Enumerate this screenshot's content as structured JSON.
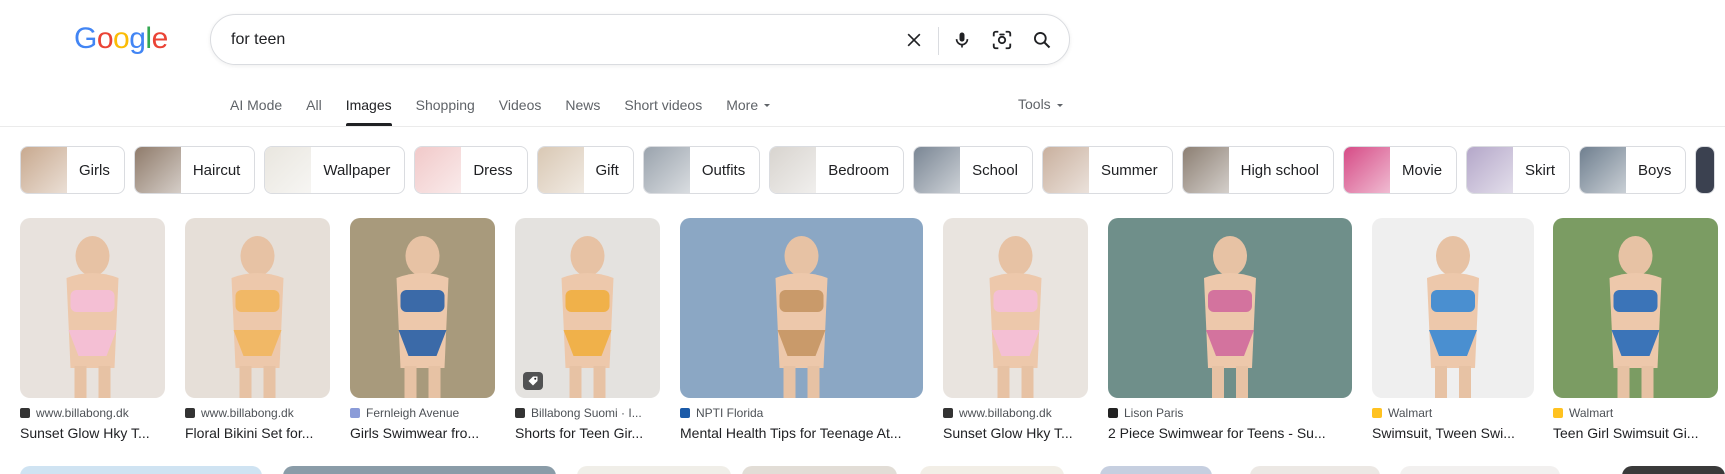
{
  "search": {
    "query": "for teen"
  },
  "nav": {
    "tabs": [
      "AI Mode",
      "All",
      "Images",
      "Shopping",
      "Videos",
      "News",
      "Short videos"
    ],
    "more_label": "More",
    "tools_label": "Tools",
    "active_tab": "Images"
  },
  "chips": [
    {
      "label": "Girls",
      "color": "#c8a98f"
    },
    {
      "label": "Haircut",
      "color": "#8f7b6b"
    },
    {
      "label": "Wallpaper",
      "color": "#e9e6df"
    },
    {
      "label": "Dress",
      "color": "#f1c9c9"
    },
    {
      "label": "Gift",
      "color": "#d9c8b4"
    },
    {
      "label": "Outfits",
      "color": "#9aa3ad"
    },
    {
      "label": "Bedroom",
      "color": "#d8d4cf"
    },
    {
      "label": "School",
      "color": "#7a8694"
    },
    {
      "label": "Summer",
      "color": "#c9b09e"
    },
    {
      "label": "High school",
      "color": "#8c7f73"
    },
    {
      "label": "Movie",
      "color": "#d64b86"
    },
    {
      "label": "Skirt",
      "color": "#b4a7c9"
    },
    {
      "label": "Boys",
      "color": "#6f7f8f"
    }
  ],
  "results": [
    {
      "source": "www.billabong.dk",
      "title": "Sunset Glow Hky T...",
      "img_color": "#e8e2dd",
      "accent": "#f4bfd4",
      "fav_color": "#333333"
    },
    {
      "source": "www.billabong.dk",
      "title": "Floral Bikini Set for...",
      "img_color": "#e6dfd8",
      "accent": "#f1b866",
      "fav_color": "#333333"
    },
    {
      "source": "Fernleigh Avenue",
      "title": "Girls Swimwear fro...",
      "img_color": "#a89a7c",
      "accent": "#3b6aa8",
      "fav_color": "#8a9bd8"
    },
    {
      "source": "Billabong Suomi · I...",
      "title": "Shorts for Teen Gir...",
      "img_color": "#e4e2df",
      "accent": "#f0b14a",
      "fav_color": "#333333"
    },
    {
      "source": "NPTI Florida",
      "title": "Mental Health Tips for Teenage At...",
      "img_color": "#8ba7c4",
      "accent": "#c99a6a",
      "fav_color": "#1a5aa8"
    },
    {
      "source": "www.billabong.dk",
      "title": "Sunset Glow Hky T...",
      "img_color": "#e9e4df",
      "accent": "#f4bfd4",
      "fav_color": "#333333"
    },
    {
      "source": "Lison Paris",
      "title": "2 Piece Swimwear for Teens - Su...",
      "img_color": "#6f8f8a",
      "accent": "#d3739e",
      "fav_color": "#222222"
    },
    {
      "source": "Walmart",
      "title": "Swimsuit, Tween Swi...",
      "img_color": "#efefef",
      "accent": "#4a8fd0",
      "fav_color": "#ffc220"
    },
    {
      "source": "Walmart",
      "title": "Teen Girl Swimsuit Gi...",
      "img_color": "#7b9c63",
      "accent": "#3b74b8",
      "fav_color": "#ffc220"
    }
  ]
}
